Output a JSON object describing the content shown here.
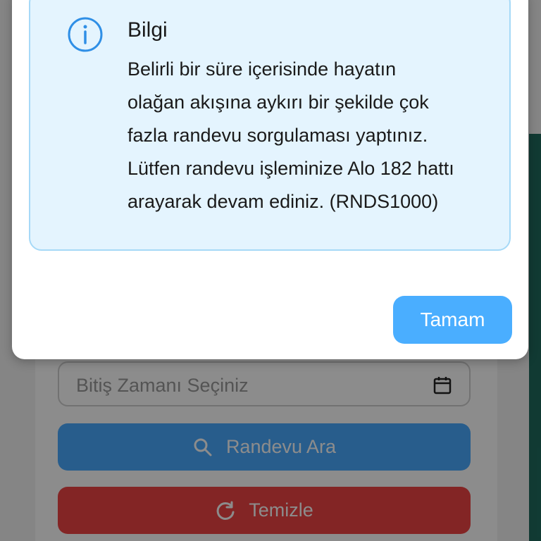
{
  "background": {
    "date_field": {
      "placeholder": "Bitiş Zamanı Seçiniz",
      "icon": "calendar-icon"
    },
    "search_button": {
      "label": "Randevu Ara",
      "icon": "search-icon"
    },
    "clear_button": {
      "label": "Temizle",
      "icon": "refresh-icon"
    }
  },
  "dialog": {
    "icon": "info-icon",
    "title": "Bilgi",
    "message": "Belirli bir süre içerisinde hayatın\nolağan akışına aykırı bir şekilde çok\nfazla randevu sorgulaması yaptınız.\nLütfen randevu işleminize Alo 182 hattı\narayarak devam ediniz. (RNDS1000)",
    "ok_label": "Tamam"
  },
  "colors": {
    "accent": "#4aaeff",
    "danger": "#ef4444",
    "info_bg": "#e4f4fe",
    "info_border": "#a6d9f7",
    "info_icon": "#2f8fe6"
  }
}
